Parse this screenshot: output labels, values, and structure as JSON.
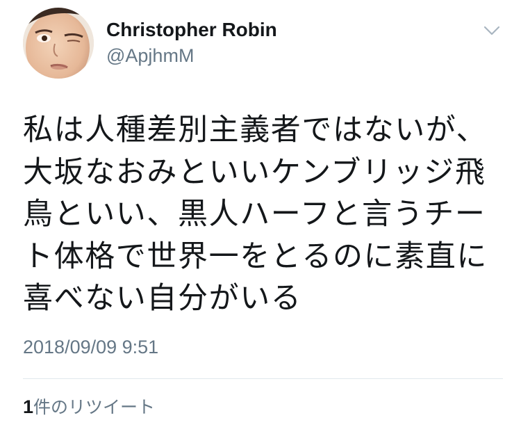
{
  "tweet": {
    "author": {
      "display_name": "Christopher Robin",
      "handle": "@ApjhmM"
    },
    "menu_icon": "chevron-down-icon",
    "text_lines": [
      "私は人種差別主義者ではないが、",
      "大坂なおみといいケンブリッジ飛",
      "鳥といい、黒人ハーフと言うチー",
      "ト体格で世界一をとるのに素直に",
      "喜べない自分がいる"
    ],
    "timestamp": "2018/09/09 9:51",
    "retweets": {
      "count": "1",
      "label": "件のリツイート"
    }
  },
  "colors": {
    "text_primary": "#14171a",
    "text_secondary": "#657786",
    "divider": "#e1e8ed",
    "background": "#ffffff"
  }
}
